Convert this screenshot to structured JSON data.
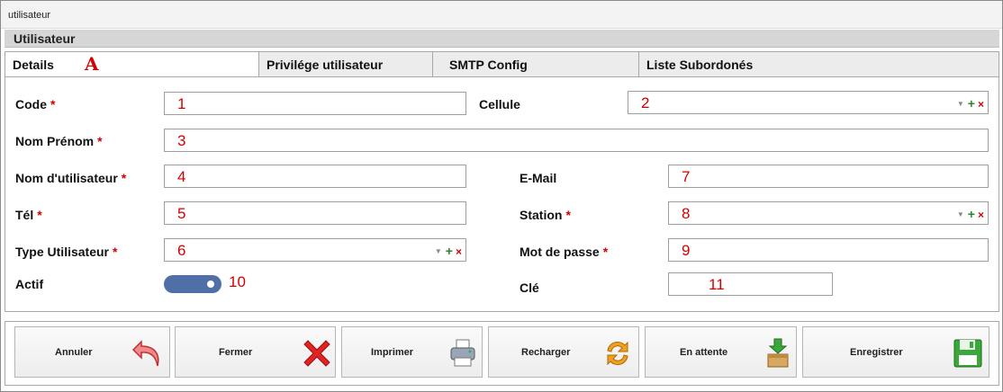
{
  "window": {
    "title": "utilisateur"
  },
  "section": {
    "title": "Utilisateur"
  },
  "tabs": [
    {
      "label": "Details",
      "marker": "A"
    },
    {
      "label": "Privilége utilisateur"
    },
    {
      "label": "SMTP Config"
    },
    {
      "label": "Liste Subordonés"
    }
  ],
  "form": {
    "code": {
      "label": "Code",
      "required": "*",
      "value": "1"
    },
    "cellule": {
      "label": "Cellule",
      "value": "2"
    },
    "nom_prenom": {
      "label": "Nom Prénom",
      "required": "*",
      "value": "3"
    },
    "nom_utilisateur": {
      "label": "Nom d'utilisateur",
      "required": "*",
      "value": "4"
    },
    "email": {
      "label": "E-Mail",
      "value": "7"
    },
    "tel": {
      "label": "Tél",
      "required": "*",
      "value": "5"
    },
    "station": {
      "label": "Station",
      "required": "*",
      "value": "8"
    },
    "type_utilisateur": {
      "label": "Type Utilisateur",
      "required": "*",
      "value": "6"
    },
    "mot_de_passe": {
      "label": "Mot de passe",
      "required": "*",
      "value": "9"
    },
    "actif": {
      "label": "Actif",
      "value": "10",
      "state": "on"
    },
    "cle": {
      "label": "Clé",
      "value": "11"
    }
  },
  "combo_icons": {
    "dropdown": "▼",
    "add": "+",
    "remove": "×"
  },
  "buttons": [
    {
      "label": "Annuler",
      "icon": "undo-arrow-icon"
    },
    {
      "label": "Fermer",
      "icon": "red-x-icon"
    },
    {
      "label": "Imprimer",
      "icon": "printer-icon"
    },
    {
      "label": "Recharger",
      "icon": "refresh-icon"
    },
    {
      "label": "En attente",
      "icon": "inbox-download-icon"
    },
    {
      "label": "Enregistrer",
      "icon": "floppy-disk-icon"
    }
  ],
  "colors": {
    "annotation_red": "#d40000",
    "toggle_blue": "#4f6fa6",
    "save_green": "#3aa83a"
  }
}
